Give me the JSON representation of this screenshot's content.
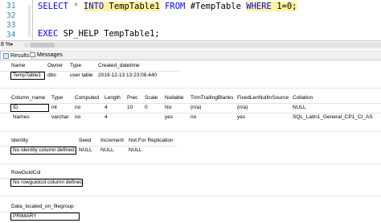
{
  "editor": {
    "line_numbers": [
      "31",
      "32",
      "33",
      "34"
    ],
    "line31": {
      "kw1": "SELECT",
      "star": "*",
      "kw2": "INTO",
      "t1": "TempTable1",
      "kw3": "FROM",
      "t2": "#TempTable",
      "kw4": "WHERE",
      "cond": "1=0;"
    },
    "line33": {
      "kw": "EXEC",
      "proc": "SP_HELP",
      "arg": "TempTable1;"
    }
  },
  "zoom": {
    "value": "8 %"
  },
  "tabs": [
    {
      "label": "Results",
      "icon": "grid-icon"
    },
    {
      "label": "Messages",
      "icon": "messages-icon"
    }
  ],
  "grid1": {
    "headers": [
      "Name",
      "Owner",
      "Type",
      "Created_datetime"
    ],
    "rows": [
      [
        "TempTable1",
        "dbo",
        "user table",
        "2019-12-13 13:23:08.440"
      ]
    ]
  },
  "grid2": {
    "headers": [
      "Column_name",
      "Type",
      "Computed",
      "Length",
      "Prec",
      "Scale",
      "Nullable",
      "TrimTrailingBlanks",
      "FixedLenNullInSource",
      "Collation"
    ],
    "rows": [
      [
        "ID",
        "int",
        "no",
        "4",
        "10",
        "0",
        "No",
        "(n/a)",
        "(n/a)",
        "NULL"
      ],
      [
        "Names",
        "varchar",
        "no",
        "4",
        "",
        "",
        "yes",
        "no",
        "yes",
        "SQL_Latin1_General_CP1_CI_AS"
      ]
    ]
  },
  "grid3": {
    "headers": [
      "Identity",
      "Seed",
      "Increment",
      "Not For Replication"
    ],
    "rows": [
      [
        "No identity column defined.",
        "NULL",
        "NULL",
        "NULL"
      ]
    ]
  },
  "grid4": {
    "headers": [
      "RowGuidCol"
    ],
    "rows": [
      [
        "No rowguidcol column defined."
      ]
    ]
  },
  "grid5": {
    "headers": [
      "Data_located_on_filegroup"
    ],
    "rows": [
      [
        "PRIMARY"
      ]
    ]
  }
}
